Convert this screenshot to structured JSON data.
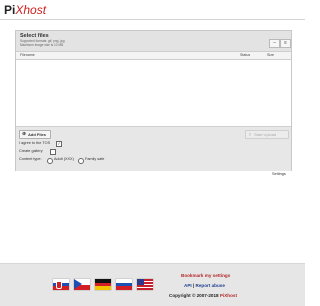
{
  "brand": {
    "logo_part1": "Pi",
    "logo_part2": "Xhost"
  },
  "uploader": {
    "title": "Select files",
    "formats": "Supported formats: gif, png, jpg",
    "max_size": "Maximum image size is 10 MB",
    "toolbar_icons": [
      "minus-icon",
      "grid-icon"
    ],
    "columns": {
      "filename": "Filename",
      "status": "Status",
      "size": "Size"
    },
    "add_files_label": "Add Files",
    "start_upload_label": "Start Upload",
    "tos_label": "I agree to the TOS",
    "tos_checked": true,
    "gallery_label": "Create gallery",
    "gallery_checked": false,
    "content_type_label": "Content type:",
    "content_options": [
      "Adult (XXX)",
      "Family safe"
    ],
    "settings_label": "Settings"
  },
  "footer": {
    "bookmark": "Bookmark my settings",
    "api": "API",
    "separator": "|",
    "report": "Report abuse",
    "copyright": "Copyright © 2007-2018",
    "copyright_brand": "PiXhost",
    "flags": [
      "slovakia-flag",
      "czech-flag",
      "germany-flag",
      "russia-flag",
      "usa-flag"
    ]
  },
  "colors": {
    "brand_red": "#cc1f1f",
    "link_red": "#b5282a",
    "link_blue": "#1d3f8f"
  }
}
